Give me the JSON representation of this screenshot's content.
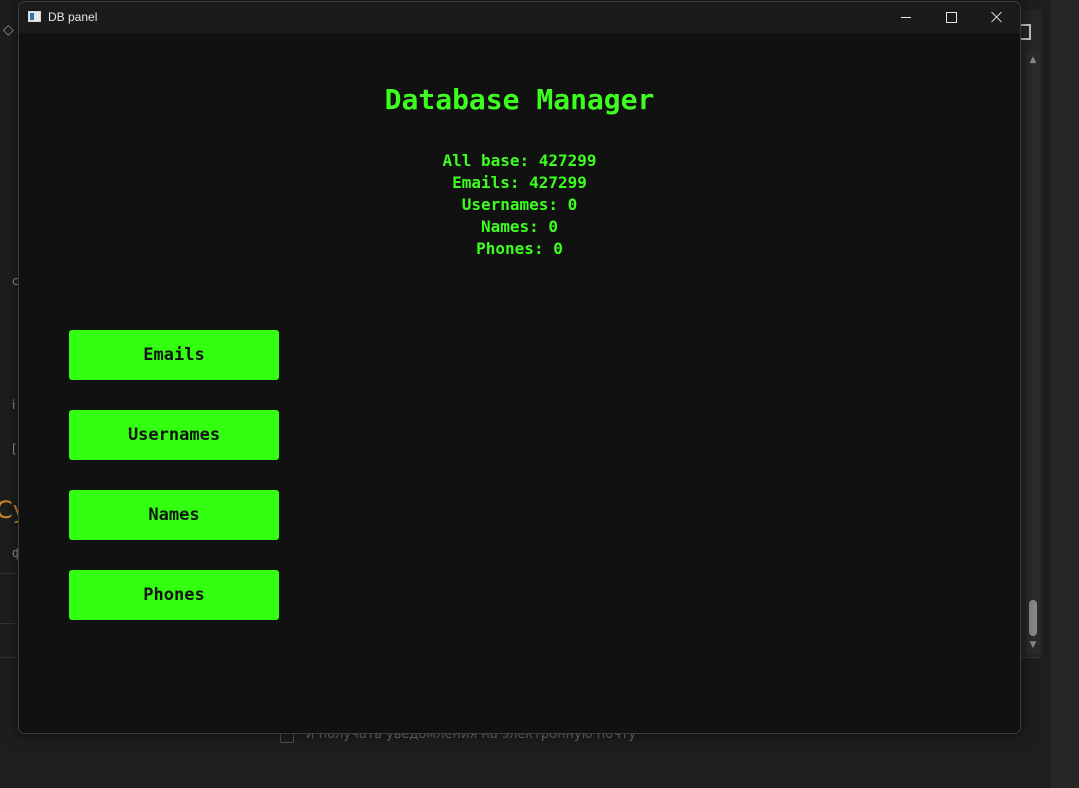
{
  "window": {
    "title": "DB panel"
  },
  "app": {
    "heading": "Database Manager",
    "stats": [
      "All base: 427299",
      "Emails: 427299",
      "Usernames: 0",
      "Names: 0",
      "Phones: 0"
    ],
    "buttons": [
      "Emails",
      "Usernames",
      "Names",
      "Phones"
    ]
  },
  "background": {
    "checkbox_label": "и получать уведомления на электронную почту",
    "frag_orange": "Cy",
    "frag_c": "c",
    "frag_i": "i",
    "frag_bracket": "[",
    "frag_phi": "ф"
  },
  "colors": {
    "accent_green": "#33ff11",
    "text_green": "#3dff1f",
    "window_bg": "#111111"
  },
  "icons": {
    "app": "app-window-icon",
    "minimize": "minimize-icon",
    "maximize": "maximize-icon",
    "close": "close-icon"
  }
}
